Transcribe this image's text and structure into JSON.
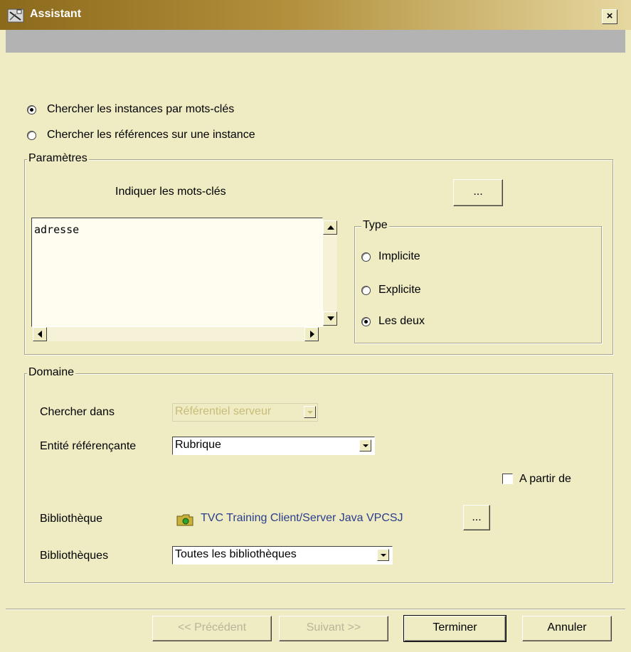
{
  "window": {
    "title": "Assistant",
    "close_label": "×"
  },
  "search_mode": {
    "options": [
      {
        "label": "Chercher les instances par mots-clés",
        "checked": true
      },
      {
        "label": "Chercher les références sur une instance",
        "checked": false
      }
    ]
  },
  "parameters": {
    "legend": "Paramètres",
    "keywords_label": "Indiquer les mots-clés",
    "browse_label": "...",
    "keywords_value": "adresse",
    "type": {
      "legend": "Type",
      "options": [
        {
          "label": "Implicite",
          "checked": false
        },
        {
          "label": "Explicite",
          "checked": false
        },
        {
          "label": "Les deux",
          "checked": true
        }
      ]
    }
  },
  "domain": {
    "legend": "Domaine",
    "search_in_label": "Chercher dans",
    "search_in_value": "Référentiel serveur",
    "entity_label": "Entité référençante",
    "entity_value": "Rubrique",
    "from_label": "A partir de",
    "from_checked": false,
    "library_label": "Bibliothèque",
    "library_value": "TVC Training Client/Server Java VPCSJ",
    "library_browse_label": "...",
    "libraries_label": "Bibliothèques",
    "libraries_value": "Toutes les bibliothèques"
  },
  "footer": {
    "previous_label": "<< Précédent",
    "next_label": "Suivant >>",
    "finish_label": "Terminer",
    "cancel_label": "Annuler"
  },
  "colors": {
    "background": "#efebc3",
    "title_gradient_start": "#8c6a1c",
    "link": "#2b3e8c"
  }
}
